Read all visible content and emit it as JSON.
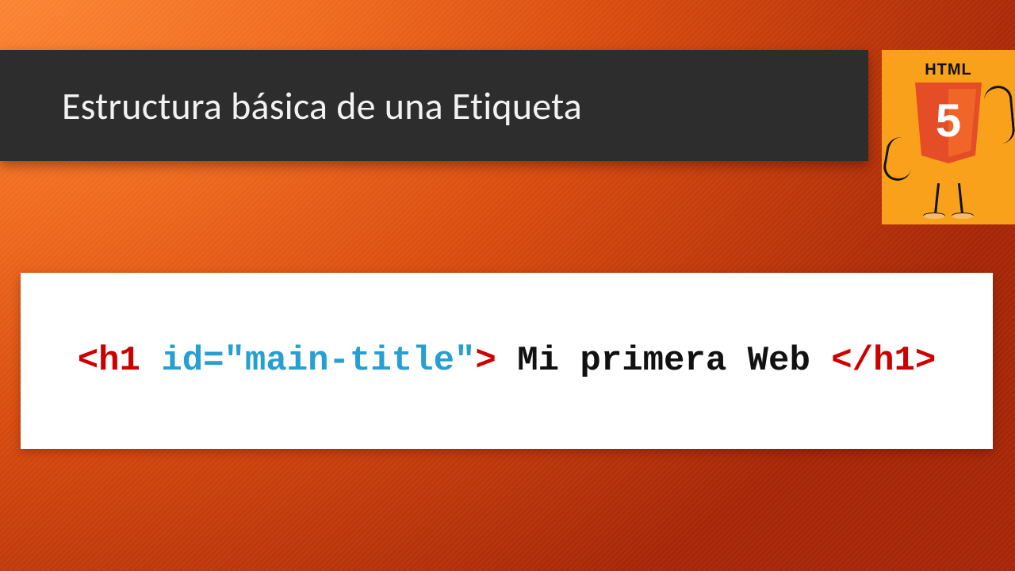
{
  "slide": {
    "title": "Estructura básica de una Etiqueta"
  },
  "logo": {
    "label": "HTML",
    "glyph": "5"
  },
  "code": {
    "open_bracket": "<",
    "tag_name": "h1",
    "space": " ",
    "attr": "id=\"main-title\"",
    "close_bracket": ">",
    "content": " Mi primera Web ",
    "close_open": "</",
    "close_tag_name": "h1",
    "close_close": ">"
  }
}
